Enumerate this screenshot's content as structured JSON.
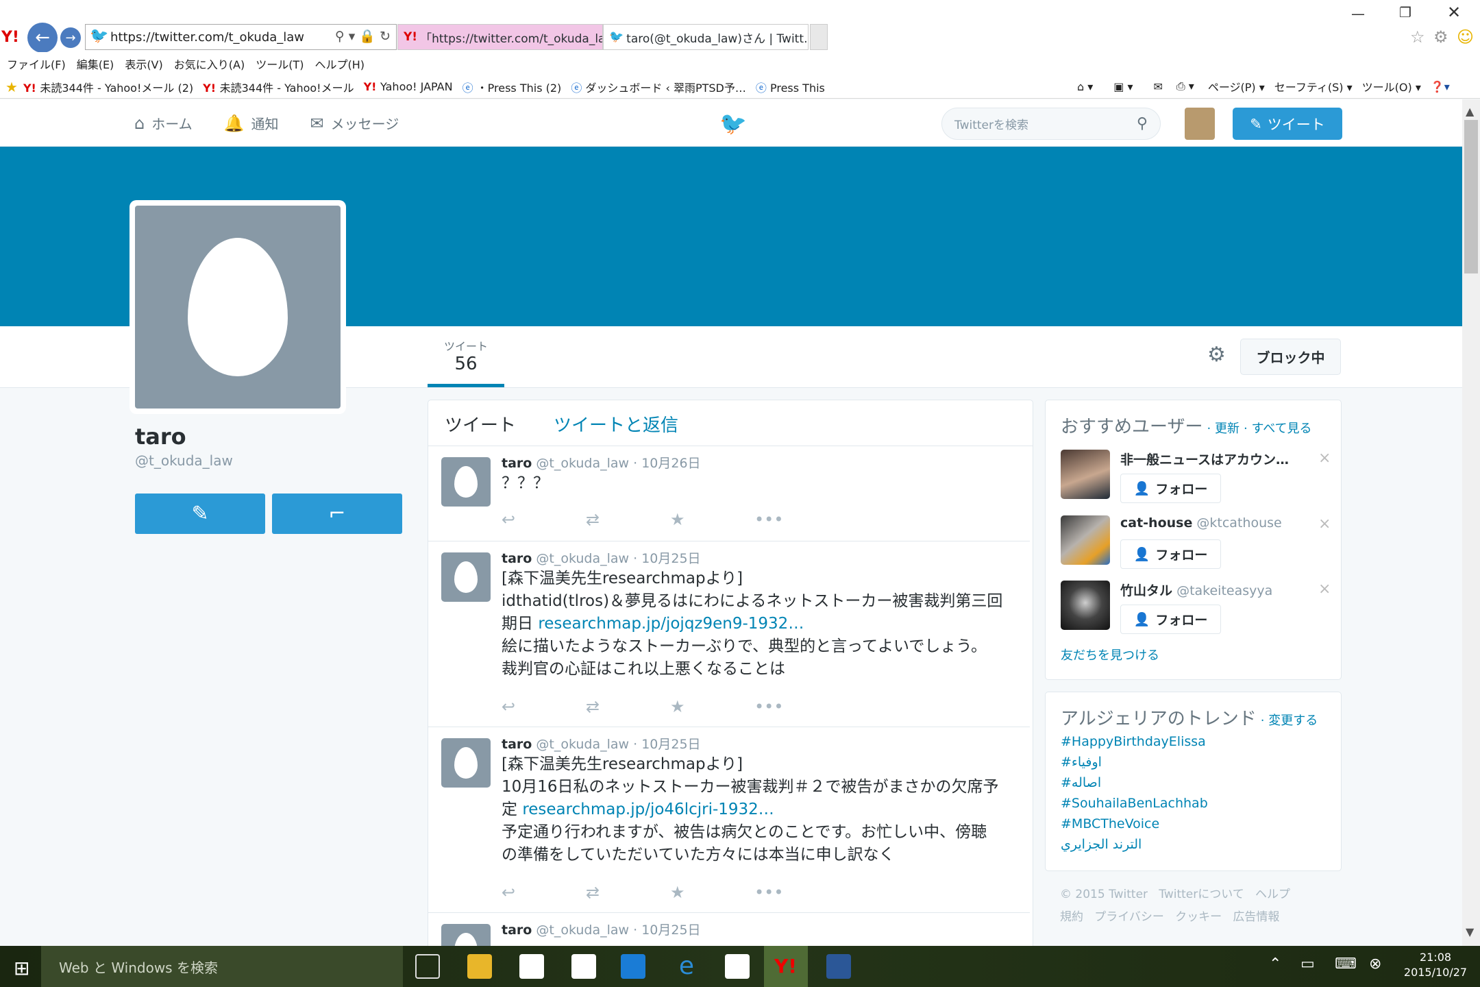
{
  "browser": {
    "address": "https://twitter.com/t_okuda_law",
    "tabs": [
      "「https://twitter.com/t_okuda_la…",
      "taro(@t_okuda_law)さん | Twitt…"
    ],
    "tab_close": "×",
    "menu": [
      "ファイル(F)",
      "編集(E)",
      "表示(V)",
      "お気に入り(A)",
      "ツール(T)",
      "ヘルプ(H)"
    ],
    "favorites": [
      "未読344件 - Yahoo!メール (2)",
      "未読344件 - Yahoo!メール",
      "Yahoo! JAPAN",
      "・Press This (2)",
      "ダッシュボード ‹ 翠雨PTSD予…",
      "Press This"
    ],
    "tools": [
      "ページ(P)",
      "セーフティ(S)",
      "ツール(O)"
    ]
  },
  "nav": {
    "home": "ホーム",
    "notifications": "通知",
    "messages": "メッセージ",
    "search_placeholder": "Twitterを検索",
    "tweet_button": "ツイート"
  },
  "profile": {
    "name": "taro",
    "handle": "@t_okuda_law",
    "stat_label": "ツイート",
    "stat_value": "56",
    "blocked_button": "ブロック中"
  },
  "timeline": {
    "tab_tweets": "ツイート",
    "tab_replies": "ツイートと返信",
    "tweets": [
      {
        "name": "taro",
        "handle": "@t_okuda_law",
        "date": "· 10月26日",
        "lines": [
          "？？？"
        ],
        "link": "",
        "after": []
      },
      {
        "name": "taro",
        "handle": "@t_okuda_law",
        "date": "· 10月25日",
        "lines": [
          "[森下温美先生researchmapより]",
          "idthatid(tlros)＆夢見るはにわによるネットストーカー被害裁判第三回",
          "期日"
        ],
        "link": "researchmap.jp/jojqz9en9-1932…",
        "after": [
          "絵に描いたようなストーカーぶりで、典型的と言ってよいでしょう。",
          "裁判官の心証はこれ以上悪くなることは"
        ]
      },
      {
        "name": "taro",
        "handle": "@t_okuda_law",
        "date": "· 10月25日",
        "lines": [
          "[森下温美先生researchmapより]",
          "10月16日私のネットストーカー被害裁判＃２で被告がまさかの欠席予",
          "定"
        ],
        "link": "researchmap.jp/jo46lcjri-1932…",
        "after": [
          "予定通り行われますが、被告は病欠とのことです。お忙しい中、傍聴",
          "の準備をしていただいていた方々には本当に申し訳なく"
        ]
      },
      {
        "name": "taro",
        "handle": "@t_okuda_law",
        "date": "· 10月25日",
        "lines": [],
        "link": "",
        "after": []
      }
    ]
  },
  "suggestions": {
    "title": "おすすめユーザー",
    "refresh": "· 更新",
    "view_all": "· すべて見る",
    "follow_label": "フォロー",
    "dismiss": "×",
    "users": [
      {
        "name": "非一般ニュースはアカウン…",
        "handle": ""
      },
      {
        "name": "cat-house",
        "handle": "@ktcathouse"
      },
      {
        "name": "竹山タル",
        "handle": "@takeiteasyya"
      }
    ],
    "find_friends": "友だちを見つける"
  },
  "trends": {
    "title": "アルジェリアのトレンド",
    "change": "· 変更する",
    "items": [
      "#HappyBirthdayElissa",
      "#اوفياء",
      "#اصاله",
      "#SouhailaBenLachhab",
      "#MBCTheVoice",
      "الترند الجزايري"
    ]
  },
  "footer": {
    "line1": [
      "© 2015 Twitter",
      "Twitterについて",
      "ヘルプ"
    ],
    "line2": [
      "規約",
      "プライバシー",
      "クッキー",
      "広告情報"
    ]
  },
  "taskbar": {
    "search": "Web と Windows を検索",
    "time": "21:08",
    "date": "2015/10/27"
  },
  "colors": {
    "accent": "#0084b4",
    "button": "#2b9ad6",
    "egg_bg": "#8899a6"
  }
}
